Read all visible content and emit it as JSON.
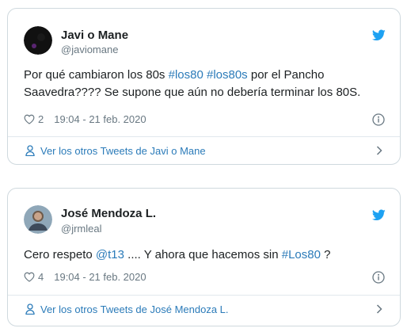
{
  "tweets": [
    {
      "author_name": "Javi o Mane",
      "author_handle": "@javiomane",
      "text_segments": [
        {
          "text": "Por qué cambiaron los 80s ",
          "type": "text"
        },
        {
          "text": "#los80",
          "type": "hashtag"
        },
        {
          "text": " ",
          "type": "text"
        },
        {
          "text": "#los80s",
          "type": "hashtag"
        },
        {
          "text": " por el Pancho Saavedra???? Se supone que aún no debería terminar los 80S.",
          "type": "text"
        }
      ],
      "likes": "2",
      "timestamp": "19:04 - 21 feb. 2020",
      "more_tweets_label": "Ver los otros Tweets de Javi o Mane"
    },
    {
      "author_name": "José Mendoza L.",
      "author_handle": "@jrmleal",
      "text_segments": [
        {
          "text": "Cero respeto ",
          "type": "text"
        },
        {
          "text": "@t13",
          "type": "mention"
        },
        {
          "text": " .... Y ahora que hacemos sin ",
          "type": "text"
        },
        {
          "text": "#Los80",
          "type": "hashtag"
        },
        {
          "text": " ?",
          "type": "text"
        }
      ],
      "likes": "4",
      "timestamp": "19:04 - 21 feb. 2020",
      "more_tweets_label": "Ver los otros Tweets de José Mendoza L."
    }
  ],
  "colors": {
    "link": "#2b7bb9",
    "text": "#1c2022",
    "muted": "#697882",
    "border": "#cfd9de",
    "twitter_blue": "#1da1f2"
  },
  "icons": [
    "twitter-bird-icon",
    "heart-icon",
    "info-icon",
    "person-icon",
    "chevron-right-icon"
  ]
}
